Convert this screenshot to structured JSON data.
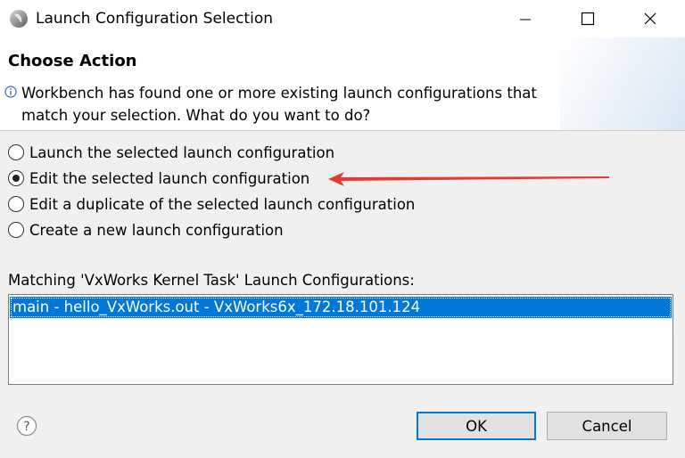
{
  "window": {
    "title": "Launch Configuration Selection",
    "minimize_icon": "minimize-icon",
    "maximize_icon": "maximize-icon",
    "close_icon": "close-icon"
  },
  "header": {
    "section_title": "Choose Action",
    "message_line1": "Workbench has found one or more existing launch configurations that",
    "message_line2": "match your selection. What do you want to do?"
  },
  "options": [
    {
      "label": "Launch the selected launch configuration",
      "checked": false
    },
    {
      "label": "Edit the selected launch configuration",
      "checked": true
    },
    {
      "label": "Edit a duplicate of the selected launch configuration",
      "checked": false
    },
    {
      "label": "Create a new launch configuration",
      "checked": false
    }
  ],
  "list": {
    "label": "Matching 'VxWorks Kernel Task' Launch Configurations:",
    "items": [
      "main - hello_VxWorks.out - VxWorks6x_172.18.101.124"
    ]
  },
  "buttons": {
    "ok": "OK",
    "cancel": "Cancel"
  },
  "colors": {
    "selection": "#0078d7",
    "arrow": "#e8392f"
  }
}
